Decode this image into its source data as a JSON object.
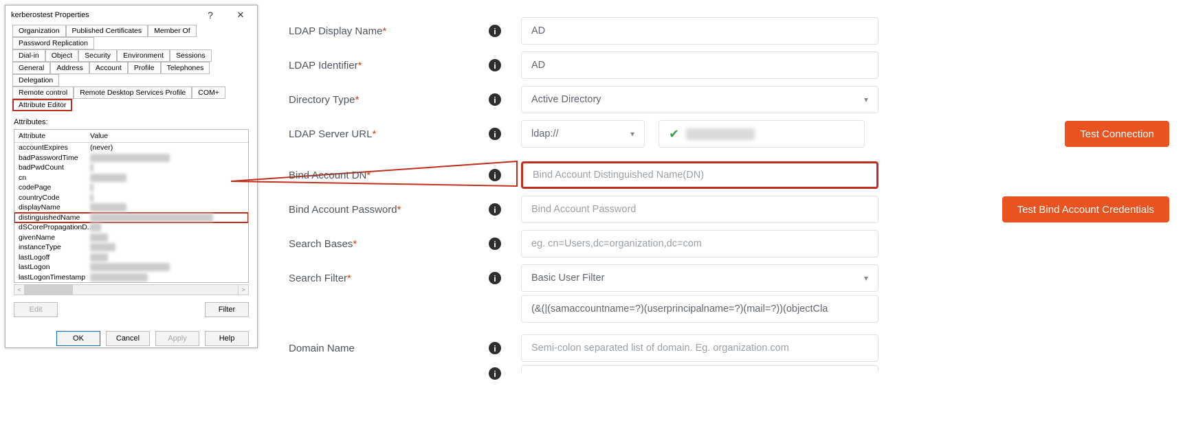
{
  "dialog": {
    "title": "kerberostest Properties",
    "help": "?",
    "close": "✕",
    "tabs_row1": [
      "Organization",
      "Published Certificates",
      "Member Of",
      "Password Replication"
    ],
    "tabs_row2": [
      "Dial-in",
      "Object",
      "Security",
      "Environment",
      "Sessions"
    ],
    "tabs_row3": [
      "General",
      "Address",
      "Account",
      "Profile",
      "Telephones",
      "Delegation"
    ],
    "tabs_row4": [
      "Remote control",
      "Remote Desktop Services Profile",
      "COM+",
      "Attribute Editor"
    ],
    "selected_tab": "Attribute Editor",
    "attributes_label": "Attributes:",
    "col_attr": "Attribute",
    "col_val": "Value",
    "rows": [
      {
        "a": "accountExpires",
        "v": "(never)",
        "readable": true
      },
      {
        "a": "badPasswordTime",
        "v": "xxxxxxxxxxxxxxxxxxxxxx"
      },
      {
        "a": "badPwdCount",
        "v": "x"
      },
      {
        "a": "cn",
        "v": "xxxxxxxxxx"
      },
      {
        "a": "codePage",
        "v": "x"
      },
      {
        "a": "countryCode",
        "v": "x"
      },
      {
        "a": "displayName",
        "v": "xxxxxxxxxx"
      },
      {
        "a": "distinguishedName",
        "v": "xxxxxxxxxxxxxxxxxxxxxxxxxxxxxxxxxx",
        "hl": true
      },
      {
        "a": "dSCorePropagationD...",
        "v": "xxx"
      },
      {
        "a": "givenName",
        "v": "xxxxx"
      },
      {
        "a": "instanceType",
        "v": "xxxxxxx"
      },
      {
        "a": "lastLogoff",
        "v": "xxxxx"
      },
      {
        "a": "lastLogon",
        "v": "xxxxxxxxxxxxxxxxxxxxxx"
      },
      {
        "a": "lastLogonTimestamp",
        "v": "xxxxxxxxxxxxxxxx"
      }
    ],
    "edit": "Edit",
    "filter": "Filter",
    "ok": "OK",
    "cancel": "Cancel",
    "apply": "Apply",
    "helpbtn": "Help"
  },
  "form": {
    "ldap_display_name": {
      "label": "LDAP Display Name",
      "value": "AD"
    },
    "ldap_identifier": {
      "label": "LDAP Identifier",
      "value": "AD"
    },
    "directory_type": {
      "label": "Directory Type",
      "value": "Active Directory"
    },
    "ldap_server_url": {
      "label": "LDAP Server URL",
      "proto": "ldap://",
      "ip_masked": "00.000.000.00"
    },
    "test_connection": "Test Connection",
    "bind_dn": {
      "label": "Bind Account DN",
      "placeholder": "Bind Account Distinguished Name(DN)"
    },
    "bind_pw": {
      "label": "Bind Account Password",
      "placeholder": "Bind Account Password"
    },
    "test_bind": "Test Bind Account Credentials",
    "search_bases": {
      "label": "Search Bases",
      "placeholder": "eg. cn=Users,dc=organization,dc=com"
    },
    "search_filter": {
      "label": "Search Filter",
      "value": "Basic User Filter"
    },
    "filter_expr": "(&(|(samaccountname=?)(userprincipalname=?)(mail=?))(objectCla",
    "domain_name": {
      "label": "Domain Name",
      "placeholder": "Semi-colon separated list of domain. Eg. organization.com"
    }
  }
}
